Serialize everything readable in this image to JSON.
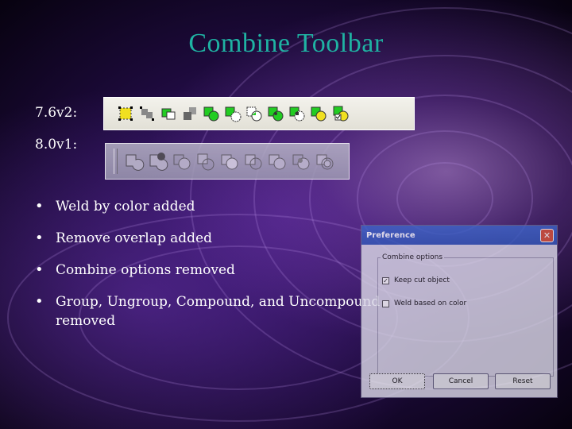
{
  "slide": {
    "title": "Combine Toolbar",
    "label_v1": "7.6v2:",
    "label_v2": "8.0v1:",
    "bullets": [
      "Weld by color added",
      "Remove overlap added",
      "Combine options removed",
      "Group, Ungroup, Compound, and Uncompound removed"
    ]
  },
  "toolbar_762": {
    "icons": [
      "group-icon",
      "ungroup-icon",
      "compound-icon",
      "uncompound-icon",
      "weld-icon",
      "intersect-icon",
      "trim-icon",
      "weld-by-color-icon",
      "remove-overlap-icon",
      "divide-icon",
      "combine-options-icon"
    ]
  },
  "toolbar_801": {
    "icons": [
      "weld-icon",
      "weld-by-color-icon",
      "intersect-icon",
      "trim-icon",
      "remove-overlap-icon",
      "divide-icon",
      "combine-icon",
      "split-icon",
      "separate-icon"
    ]
  },
  "dialog": {
    "title": "Preference",
    "close": "✕",
    "group_label": "Combine options",
    "keep_cut_object": "Keep cut object",
    "keep_cut_object_checked": "✓",
    "weld_based_on_color": "Weld based on color",
    "ok": "OK",
    "cancel": "Cancel",
    "reset": "Reset"
  },
  "colors": {
    "title": "#1fb3a3",
    "icon_green": "#22cc22",
    "icon_yellow": "#f0e020",
    "dialog_titlebar": "#3f64c8"
  }
}
